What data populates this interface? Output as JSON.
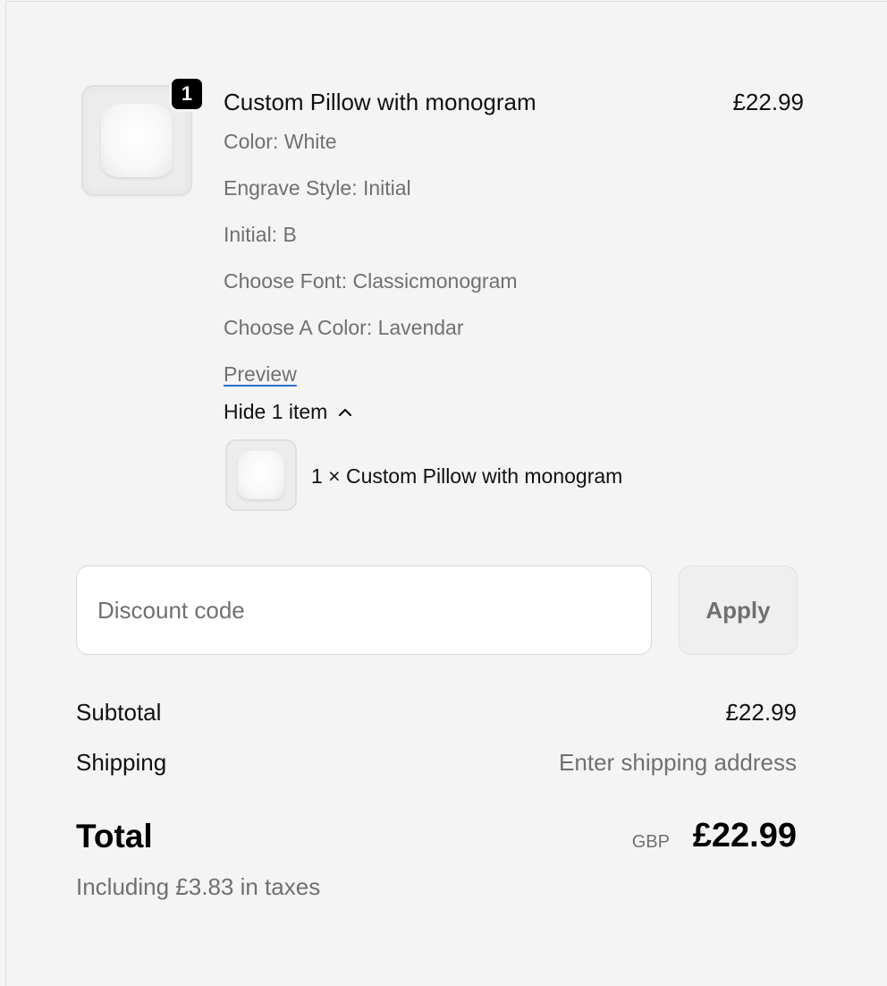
{
  "item": {
    "quantity_badge": "1",
    "title": "Custom Pillow with monogram",
    "price": "£22.99",
    "options": [
      "Color: White",
      "Engrave Style: Initial",
      "Initial: B",
      "Choose Font: Classicmonogram",
      "Choose A Color: Lavendar"
    ],
    "preview_link": "Preview",
    "toggle_label": "Hide 1 item",
    "toggle_icon": "chevron-up-icon",
    "sub_item_label": "1 × Custom Pillow with monogram"
  },
  "discount": {
    "placeholder": "Discount code",
    "value": "",
    "apply_label": "Apply"
  },
  "summary": {
    "subtotal_label": "Subtotal",
    "subtotal_value": "£22.99",
    "shipping_label": "Shipping",
    "shipping_value": "Enter shipping address",
    "total_label": "Total",
    "currency": "GBP",
    "total_value": "£22.99",
    "tax_note": "Including £3.83 in taxes"
  },
  "colors": {
    "accent_underline": "#2c6ecb",
    "muted_text": "#707070",
    "badge_bg": "#000000"
  }
}
